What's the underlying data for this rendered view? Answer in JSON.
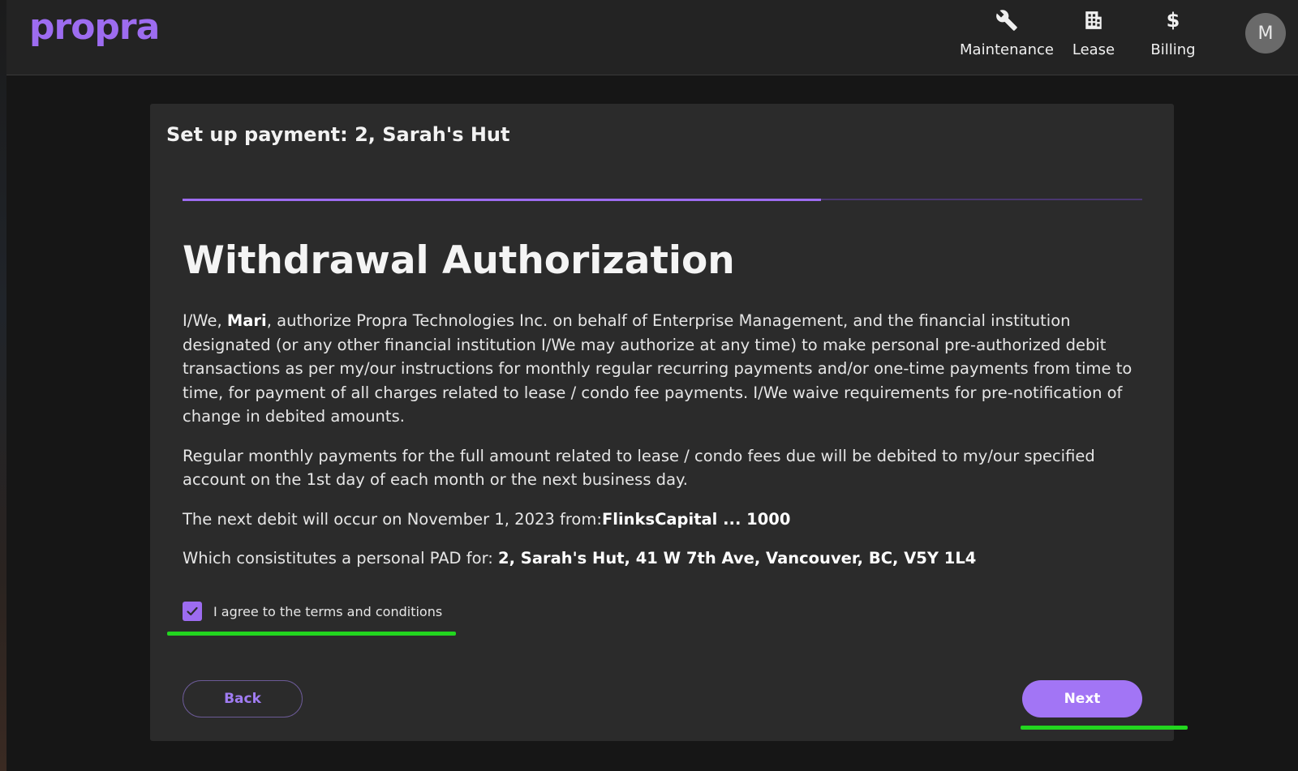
{
  "app": {
    "logo": "propra"
  },
  "nav": {
    "items": [
      {
        "label": "Maintenance",
        "icon": "wrench-icon"
      },
      {
        "label": "Lease",
        "icon": "building-icon"
      },
      {
        "label": "Billing",
        "icon": "dollar-icon",
        "glyph": "$"
      }
    ],
    "avatar_initial": "M"
  },
  "card": {
    "title": "Set up payment: 2, Sarah's Hut",
    "progress_percent": 66.5,
    "section_title": "Withdrawal Authorization",
    "para1": {
      "prefix": "I/We, ",
      "name": "Mari",
      "rest": ", authorize Propra Technologies Inc. on behalf of Enterprise Management, and the financial institution designated (or any other financial institution I/We may authorize at any time) to make personal pre-authorized debit transactions as per my/our instructions for monthly regular recurring payments and/or one-time payments from time to time, for payment of all charges related to lease / condo fee payments. I/We waive requirements for pre-notification of change in debited amounts."
    },
    "para2": "Regular monthly payments for the full amount related to lease / condo fees due will be debited to my/our specified account on the 1st day of each month or the next business day.",
    "para3": {
      "prefix": "The next debit will occur on November 1, 2023 from:",
      "account": "FlinksCapital ... 1000"
    },
    "para4": {
      "prefix": "Which consistitutes a personal PAD for: ",
      "address": "2, Sarah's Hut, 41 W 7th Ave, Vancouver, BC, V5Y 1L4"
    },
    "agree_label": "I agree to the terms and conditions",
    "agree_checked": true,
    "back_label": "Back",
    "next_label": "Next"
  },
  "colors": {
    "accent": "#9d6cf0",
    "highlight": "#22d61f",
    "background": "#161616",
    "card": "#2b2b2b"
  }
}
